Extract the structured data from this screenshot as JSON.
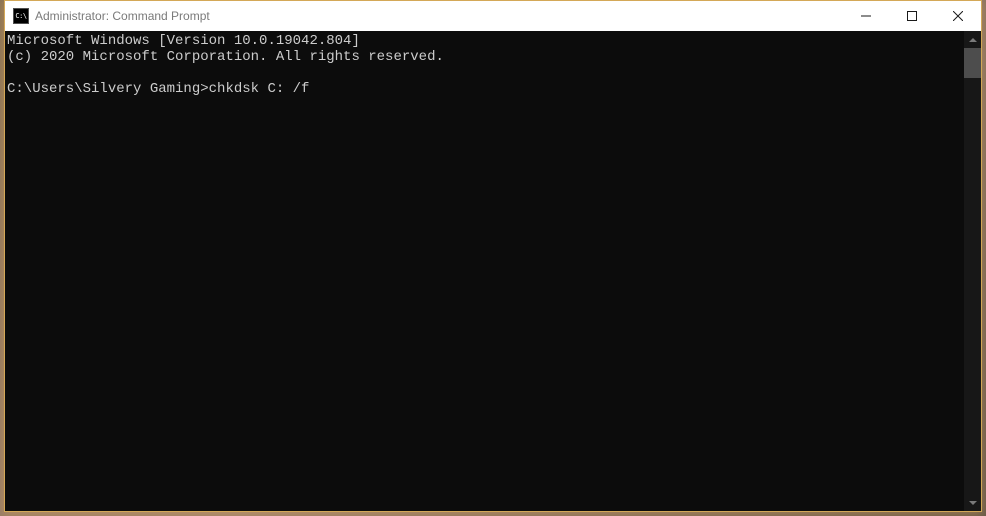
{
  "window": {
    "title": "Administrator: Command Prompt",
    "icon_label": "C:\\"
  },
  "console": {
    "line1": "Microsoft Windows [Version 10.0.19042.804]",
    "line2": "(c) 2020 Microsoft Corporation. All rights reserved.",
    "blank": "",
    "prompt": "C:\\Users\\Silvery Gaming>",
    "command": "chkdsk C: /f"
  }
}
